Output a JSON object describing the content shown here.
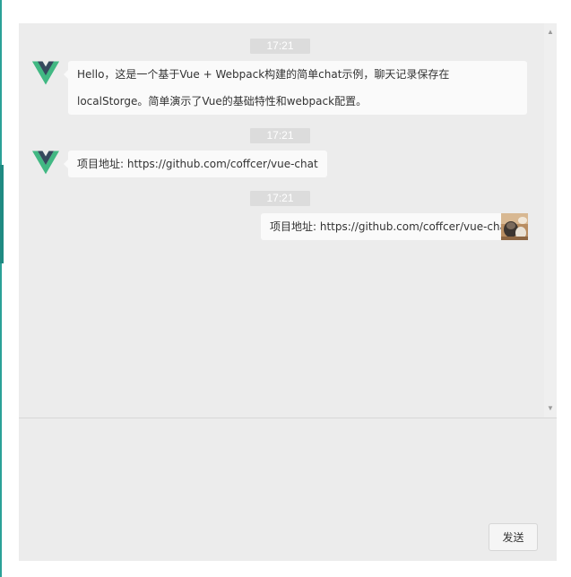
{
  "messages": [
    {
      "time": "17:21",
      "sender": "vue",
      "text": "Hello，这是一个基于Vue + Webpack构建的简单chat示例，聊天记录保存在localStorge。简单演示了Vue的基础特性和webpack配置。"
    },
    {
      "time": "17:21",
      "sender": "vue",
      "text": "项目地址: https://github.com/coffcer/vue-chat"
    },
    {
      "time": "17:21",
      "sender": "self",
      "text": "项目地址: https://github.com/coffcer/vue-chat"
    }
  ],
  "composer": {
    "value": "",
    "send_label": "发送"
  },
  "icons": {
    "bot_avatar": "vue-logo-icon",
    "user_avatar": "cat-photo-avatar",
    "scroll_up": "scroll-up-arrow-icon",
    "scroll_down": "scroll-down-arrow-icon"
  },
  "colors": {
    "vue_green": "#41b883",
    "vue_dark": "#35495e",
    "panel_bg": "#ececec",
    "bubble_bg": "#fafafa",
    "timestamp_bg": "#dcdcdc",
    "accent_edge": "#2aa197"
  }
}
